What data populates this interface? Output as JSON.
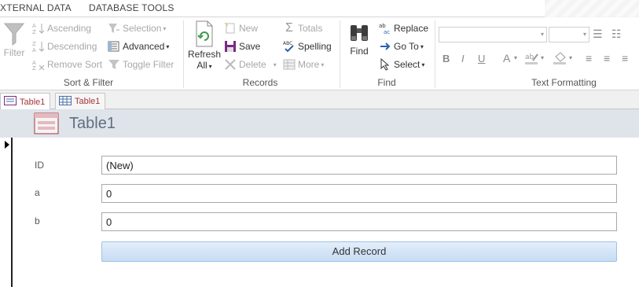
{
  "ribbon_tabs": [
    "XTERNAL DATA",
    "DATABASE TOOLS"
  ],
  "sort_filter": {
    "filter_label": "Filter",
    "ascending": "Ascending",
    "descending": "Descending",
    "remove_sort": "Remove Sort",
    "selection": "Selection",
    "advanced": "Advanced",
    "toggle_filter": "Toggle Filter",
    "group_label": "Sort & Filter"
  },
  "records": {
    "refresh_line1": "Refresh",
    "refresh_line2": "All",
    "new": "New",
    "save": "Save",
    "delete": "Delete",
    "totals": "Totals",
    "spelling": "Spelling",
    "more": "More",
    "group_label": "Records"
  },
  "find": {
    "find": "Find",
    "replace": "Replace",
    "goto": "Go To",
    "select": "Select",
    "group_label": "Find"
  },
  "text_formatting": {
    "bold": "B",
    "italic": "I",
    "underline": "U",
    "font_color": "A",
    "group_label": "Text Formatting"
  },
  "doc_tabs": [
    "Table1",
    "Table1"
  ],
  "form": {
    "title": "Table1",
    "fields": [
      {
        "label": "ID",
        "value": "(New)"
      },
      {
        "label": "a",
        "value": "0"
      },
      {
        "label": "b",
        "value": "0"
      }
    ],
    "add_button": "Add Record"
  },
  "colors": {
    "accent": "#a4373a",
    "header_bg": "#dfe3ea",
    "title_text": "#606f80",
    "button_blue": "#c6dcf4"
  }
}
